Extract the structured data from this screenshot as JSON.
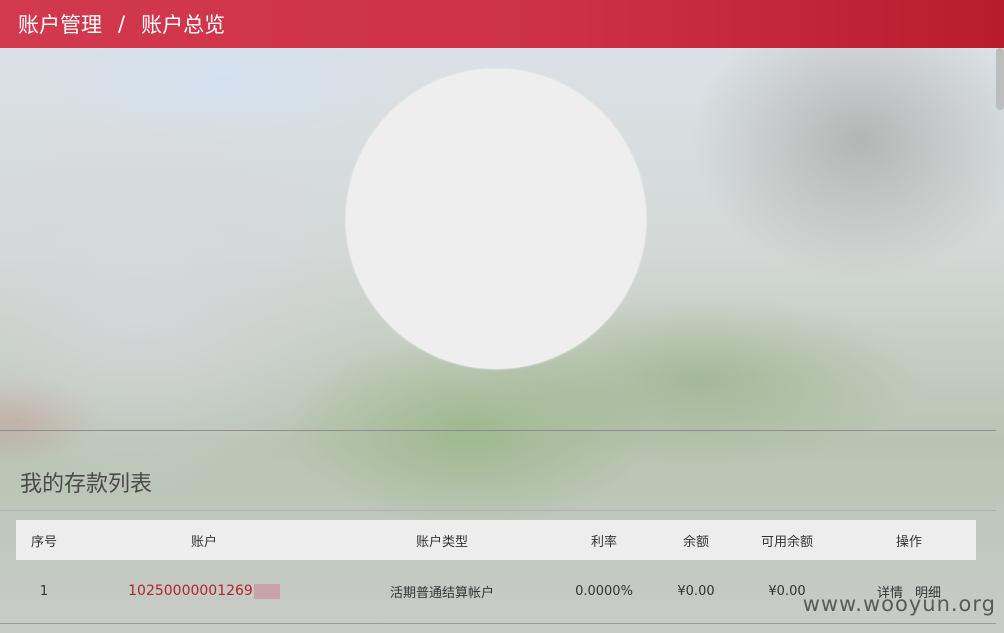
{
  "header": {
    "breadcrumb": [
      "账户管理",
      "账户总览"
    ],
    "separator": "/",
    "color": "#cc3148"
  },
  "avatar": {
    "color": "#eeeeee"
  },
  "deposit_list": {
    "title": "我的存款列表",
    "columns": [
      "序号",
      "账户",
      "账户类型",
      "利率",
      "余额",
      "可用余额",
      "操作"
    ],
    "rows": [
      {
        "index": "1",
        "account": "10250000001269",
        "account_type": "活期普通结算帐户",
        "rate": "0.0000%",
        "balance": "¥0.00",
        "available": "¥0.00",
        "actions": [
          "详情",
          "明细"
        ]
      }
    ]
  },
  "watermark": "www.wooyun.org",
  "colors": {
    "link": "#b0242c",
    "header": "#cc3148"
  }
}
